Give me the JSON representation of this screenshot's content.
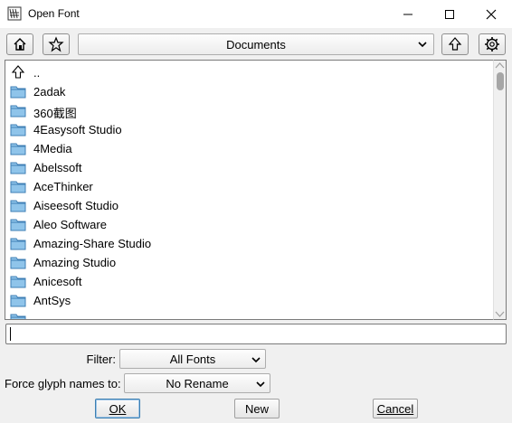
{
  "window": {
    "title": "Open Font"
  },
  "toolbar": {
    "directory": "Documents"
  },
  "file_list": {
    "items": [
      {
        "label": "..",
        "icon": "up-arrow-icon"
      },
      {
        "label": "2adak",
        "icon": "folder-icon"
      },
      {
        "label": "360截图",
        "icon": "folder-icon"
      },
      {
        "label": "4Easysoft Studio",
        "icon": "folder-icon"
      },
      {
        "label": "4Media",
        "icon": "folder-icon"
      },
      {
        "label": "Abelssoft",
        "icon": "folder-icon"
      },
      {
        "label": "AceThinker",
        "icon": "folder-icon"
      },
      {
        "label": "Aiseesoft Studio",
        "icon": "folder-icon"
      },
      {
        "label": "Aleo Software",
        "icon": "folder-icon"
      },
      {
        "label": "Amazing-Share Studio",
        "icon": "folder-icon"
      },
      {
        "label": "Amazing Studio",
        "icon": "folder-icon"
      },
      {
        "label": "Anicesoft",
        "icon": "folder-icon"
      },
      {
        "label": "AntSys",
        "icon": "folder-icon"
      }
    ]
  },
  "filename": {
    "value": ""
  },
  "filter": {
    "label": "Filter:",
    "selected": "All Fonts"
  },
  "force_glyph": {
    "label": "Force glyph names to:",
    "selected": "No Rename"
  },
  "buttons": {
    "ok": "OK",
    "new": "New",
    "cancel": "Cancel"
  },
  "colors": {
    "folder": "#8fc4ea",
    "folder_stroke": "#3f7fb5",
    "accent": "#3c7fb1"
  }
}
